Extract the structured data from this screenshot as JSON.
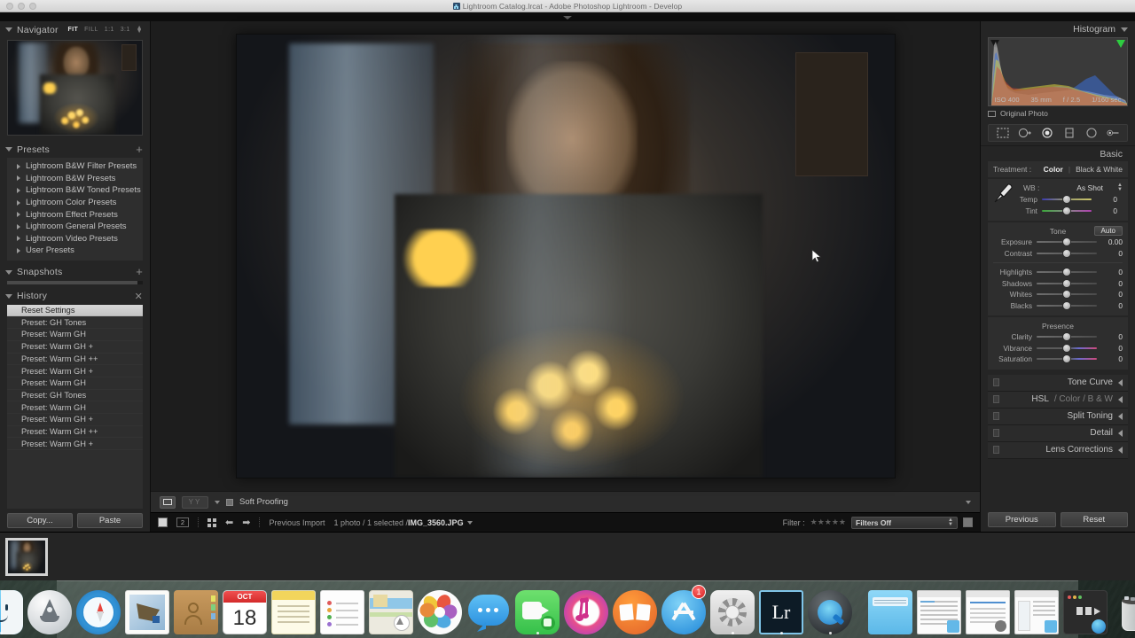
{
  "window": {
    "title": "Lightroom Catalog.lrcat - Adobe Photoshop Lightroom - Develop",
    "app_icon": "lightroom-icon"
  },
  "navigator": {
    "header": "Navigator",
    "modes": [
      "FIT",
      "FILL",
      "1:1",
      "3:1"
    ],
    "active_mode": "FIT"
  },
  "presets": {
    "header": "Presets",
    "add_label": "+",
    "items": [
      "Lightroom B&W Filter Presets",
      "Lightroom B&W Presets",
      "Lightroom B&W Toned Presets",
      "Lightroom Color Presets",
      "Lightroom Effect Presets",
      "Lightroom General Presets",
      "Lightroom Video Presets",
      "User Presets"
    ]
  },
  "snapshots": {
    "header": "Snapshots",
    "add_label": "+"
  },
  "history": {
    "header": "History",
    "clear_label": "✕",
    "selected": "Reset Settings",
    "items": [
      "Reset Settings",
      "Preset: GH Tones",
      "Preset: Warm GH",
      "Preset: Warm GH +",
      "Preset: Warm GH ++",
      "Preset: Warm GH +",
      "Preset: Warm GH",
      "Preset: GH Tones",
      "Preset: Warm GH",
      "Preset: Warm GH +",
      "Preset: Warm GH ++",
      "Preset: Warm GH +"
    ]
  },
  "left_footer": {
    "copy_label": "Copy...",
    "paste_label": "Paste"
  },
  "toolbar": {
    "soft_proofing_label": "Soft Proofing",
    "view_icon": "loupe-view-icon",
    "compare_icon": "before-after-icon"
  },
  "status": {
    "count_badge": "2",
    "previous_import": "Previous Import",
    "photo_info_prefix": "1 photo / 1 selected /",
    "filename": "IMG_3560.JPG",
    "filter_label": "Filter :",
    "filter_value": "Filters Off"
  },
  "histogram": {
    "header": "Histogram",
    "iso": "ISO 400",
    "focal": "35 mm",
    "aperture": "f / 2.5",
    "shutter": "1/160 sec",
    "original_photo_label": "Original Photo"
  },
  "tools": [
    "crop-overlay-icon",
    "spot-removal-icon",
    "red-eye-icon",
    "graduated-filter-icon",
    "radial-filter-icon",
    "adjustment-brush-icon"
  ],
  "basic": {
    "header": "Basic",
    "treatment_label": "Treatment :",
    "treatment_color": "Color",
    "treatment_bw": "Black & White",
    "wb_label": "WB :",
    "wb_value": "As Shot",
    "eyedropper_icon": "white-balance-selector-icon",
    "wb_sliders": [
      {
        "name": "Temp",
        "value": "0",
        "bar": "temp"
      },
      {
        "name": "Tint",
        "value": "0",
        "bar": "tint"
      }
    ],
    "tone_title": "Tone",
    "auto_label": "Auto",
    "tone_sliders": [
      {
        "name": "Exposure",
        "value": "0.00",
        "bar": "plain"
      },
      {
        "name": "Contrast",
        "value": "0",
        "bar": "plain"
      }
    ],
    "tone_sliders2": [
      {
        "name": "Highlights",
        "value": "0",
        "bar": "plain"
      },
      {
        "name": "Shadows",
        "value": "0",
        "bar": "plain"
      },
      {
        "name": "Whites",
        "value": "0",
        "bar": "plain"
      },
      {
        "name": "Blacks",
        "value": "0",
        "bar": "plain"
      }
    ],
    "presence_title": "Presence",
    "presence_sliders": [
      {
        "name": "Clarity",
        "value": "0",
        "bar": "plain"
      },
      {
        "name": "Vibrance",
        "value": "0",
        "bar": "vib"
      },
      {
        "name": "Saturation",
        "value": "0",
        "bar": "vib"
      }
    ]
  },
  "collapsed_panels": [
    {
      "name": "Tone Curve",
      "sub": ""
    },
    {
      "name": "HSL",
      "sub": "/  Color  /  B & W"
    },
    {
      "name": "Split Toning",
      "sub": ""
    },
    {
      "name": "Detail",
      "sub": ""
    },
    {
      "name": "Lens Corrections",
      "sub": ""
    }
  ],
  "right_footer": {
    "previous_label": "Previous",
    "reset_label": "Reset"
  },
  "dock": {
    "items": [
      {
        "name": "finder-icon",
        "running": true
      },
      {
        "name": "launchpad-icon",
        "running": false
      },
      {
        "name": "safari-icon",
        "running": false
      },
      {
        "name": "mail-icon",
        "running": false
      },
      {
        "name": "contacts-icon",
        "running": false
      },
      {
        "name": "calendar-icon",
        "running": false,
        "month": "OCT",
        "day": "18"
      },
      {
        "name": "notes-icon",
        "running": false
      },
      {
        "name": "reminders-icon",
        "running": false
      },
      {
        "name": "maps-icon",
        "running": false
      },
      {
        "name": "photos-icon",
        "running": false
      },
      {
        "name": "messages-icon",
        "running": false
      },
      {
        "name": "facetime-icon",
        "running": true
      },
      {
        "name": "itunes-icon",
        "running": false
      },
      {
        "name": "ibooks-icon",
        "running": false
      },
      {
        "name": "app-store-icon",
        "running": false,
        "badge": "1"
      },
      {
        "name": "system-preferences-icon",
        "running": true
      },
      {
        "name": "lightroom-icon",
        "running": true,
        "label": "Lr"
      },
      {
        "name": "quicktime-icon",
        "running": true
      }
    ],
    "minimized": [
      {
        "name": "downloads-folder-icon"
      },
      {
        "name": "window-preview-1"
      },
      {
        "name": "window-preview-2"
      },
      {
        "name": "window-preview-3"
      },
      {
        "name": "window-preview-4"
      },
      {
        "name": "trash-icon"
      }
    ]
  }
}
